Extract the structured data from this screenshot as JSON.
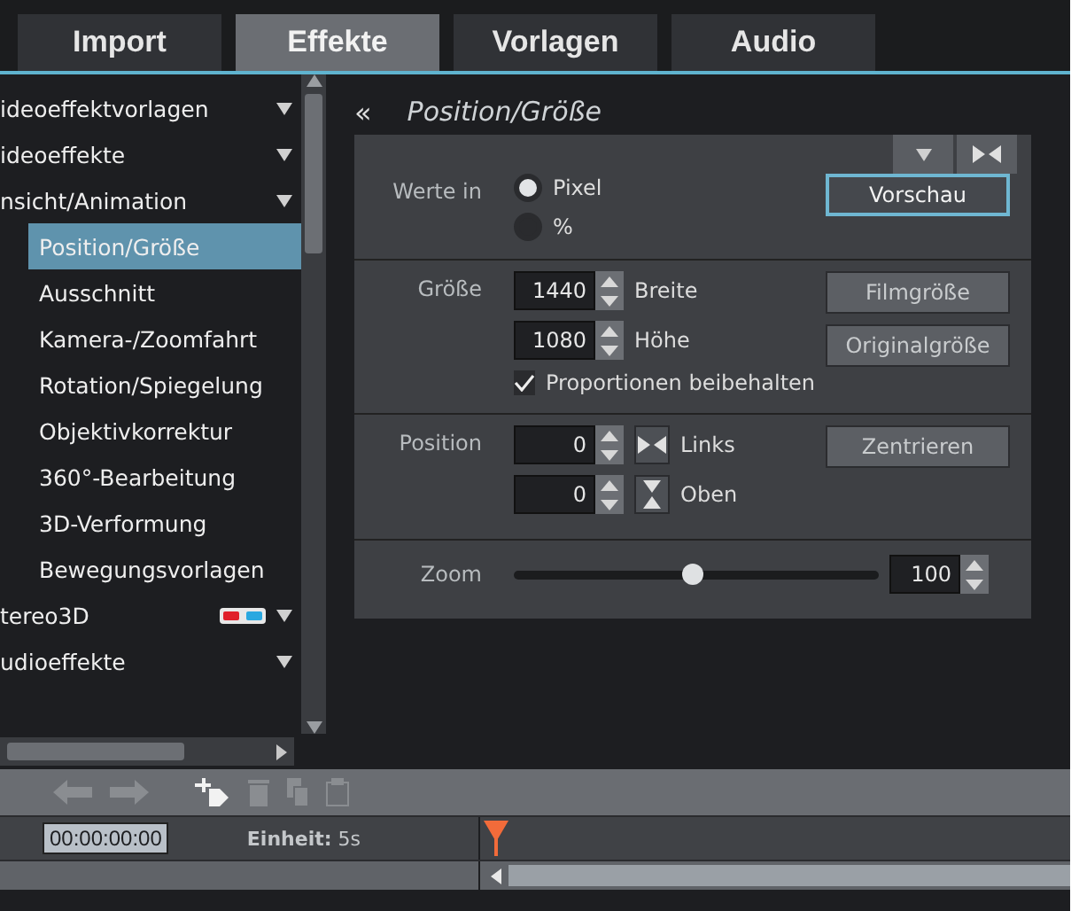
{
  "tabs": [
    {
      "label": "Import",
      "selected": false
    },
    {
      "label": "Effekte",
      "selected": true
    },
    {
      "label": "Vorlagen",
      "selected": false
    },
    {
      "label": "Audio",
      "selected": false
    }
  ],
  "sidebar": {
    "items": [
      {
        "label": "ideoeffektvorlagen",
        "glasses": false,
        "selected": false
      },
      {
        "label": "ideoeffekte",
        "glasses": false,
        "selected": false
      },
      {
        "label": "nsicht/Animation",
        "glasses": false,
        "selected": false,
        "children": [
          {
            "label": "Position/Größe",
            "selected": true
          },
          {
            "label": "Ausschnitt",
            "selected": false
          },
          {
            "label": "Kamera-/Zoomfahrt",
            "selected": false
          },
          {
            "label": "Rotation/Spiegelung",
            "selected": false
          },
          {
            "label": "Objektivkorrektur",
            "selected": false
          },
          {
            "label": "360°-Bearbeitung",
            "selected": false
          },
          {
            "label": "3D-Verformung",
            "selected": false
          },
          {
            "label": "Bewegungsvorlagen",
            "selected": false
          }
        ]
      },
      {
        "label": "tereo3D",
        "glasses": true,
        "selected": false
      },
      {
        "label": "udioeffekte",
        "glasses": false,
        "selected": false
      }
    ]
  },
  "panel": {
    "back": "«",
    "title": "Position/Größe",
    "units": {
      "label": "Werte in",
      "options": [
        {
          "label": "Pixel",
          "selected": true
        },
        {
          "label": "%",
          "selected": false
        }
      ],
      "button": "Vorschau"
    },
    "size": {
      "label": "Größe",
      "fields": [
        {
          "value": "1440",
          "label": "Breite",
          "button": "Filmgröße"
        },
        {
          "value": "1080",
          "label": "Höhe",
          "button": "Originalgröße"
        }
      ],
      "checkbox": {
        "label": "Proportionen beibehalten",
        "checked": true
      }
    },
    "position": {
      "label": "Position",
      "fields": [
        {
          "value": "0",
          "label": "Links",
          "kind": "horizontal"
        },
        {
          "value": "0",
          "label": "Oben",
          "kind": "vertical"
        }
      ],
      "button": "Zentrieren"
    },
    "zoom": {
      "label": "Zoom",
      "level": 0.49,
      "value": "100"
    }
  },
  "toolbar": [
    {
      "kind": "back",
      "disabled": true
    },
    {
      "kind": "forward",
      "disabled": true
    },
    {
      "kind": "add",
      "disabled": false
    },
    {
      "kind": "delete",
      "disabled": true
    },
    {
      "kind": "copy",
      "disabled": true
    },
    {
      "kind": "paste",
      "disabled": true
    }
  ],
  "timeline": {
    "timecode": "00:00:00:00",
    "unit": "**Einheit:** 5s"
  }
}
